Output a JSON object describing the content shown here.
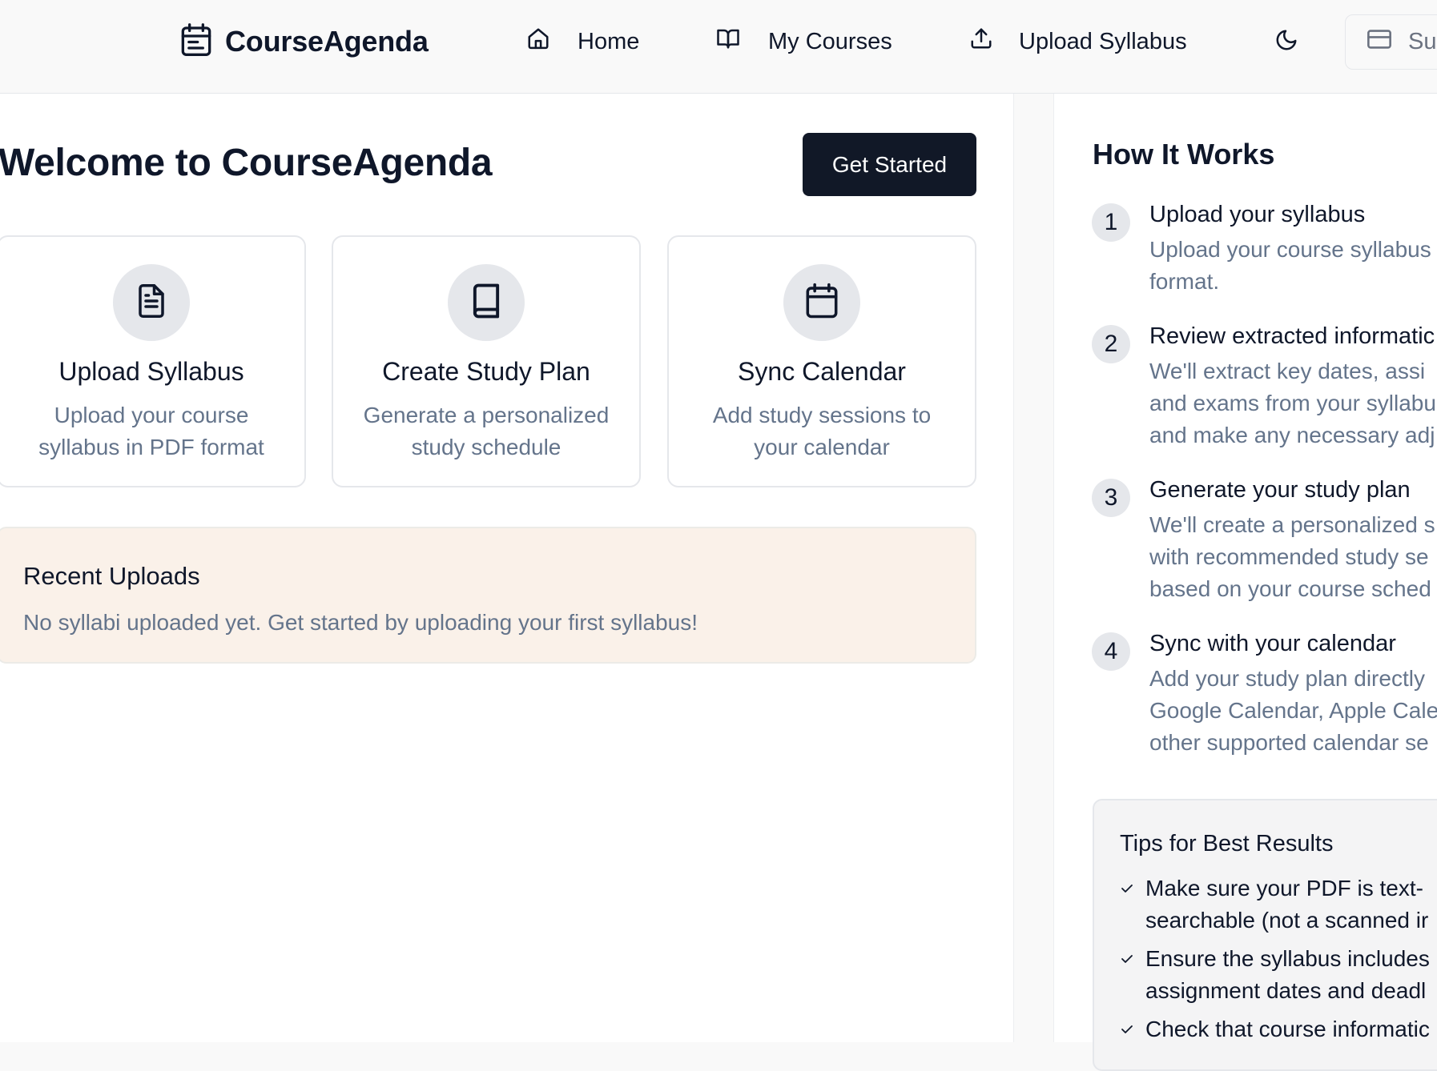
{
  "header": {
    "brand": "CourseAgenda",
    "nav": [
      {
        "label": "Home",
        "icon": "home-icon"
      },
      {
        "label": "My Courses",
        "icon": "book-open-icon"
      },
      {
        "label": "Upload Syllabus",
        "icon": "upload-icon"
      }
    ],
    "theme_icon": "moon-icon",
    "subscribe_label": "Su"
  },
  "main": {
    "title": "Welcome to CourseAgenda",
    "cta_label": "Get Started",
    "cards": [
      {
        "icon": "file-text-icon",
        "title": "Upload Syllabus",
        "description": "Upload your course syllabus in PDF format"
      },
      {
        "icon": "book-icon",
        "title": "Create Study Plan",
        "description": "Generate a personalized study schedule"
      },
      {
        "icon": "calendar-icon",
        "title": "Sync Calendar",
        "description": "Add study sessions to your calendar"
      }
    ],
    "recent": {
      "title": "Recent Uploads",
      "empty_text": "No syllabi uploaded yet. Get started by uploading your first syllabus!"
    }
  },
  "sidebar": {
    "title": "How It Works",
    "steps": [
      {
        "number": "1",
        "title": "Upload your syllabus",
        "lines": [
          "Upload your course syllabus",
          "format."
        ]
      },
      {
        "number": "2",
        "title": "Review extracted informatic",
        "lines": [
          "We'll extract key dates, assi",
          "and exams from your syllabu",
          "and make any necessary adj"
        ]
      },
      {
        "number": "3",
        "title": "Generate your study plan",
        "lines": [
          "We'll create a personalized s",
          "with recommended study se",
          "based on your course sched"
        ]
      },
      {
        "number": "4",
        "title": "Sync with your calendar",
        "lines": [
          "Add your study plan directly",
          "Google Calendar, Apple Cale",
          "other supported calendar se"
        ]
      }
    ],
    "tips": {
      "title": "Tips for Best Results",
      "items": [
        {
          "lines": [
            "Make sure your PDF is text-",
            "searchable (not a scanned ir"
          ]
        },
        {
          "lines": [
            "Ensure the syllabus includes",
            "assignment dates and deadl"
          ]
        },
        {
          "lines": [
            "Check that course informatic"
          ]
        }
      ]
    }
  },
  "colors": {
    "primary": "#111827",
    "muted_text": "#64748b",
    "recent_bg": "#faf1e9",
    "icon_circle": "#e5e7eb"
  }
}
